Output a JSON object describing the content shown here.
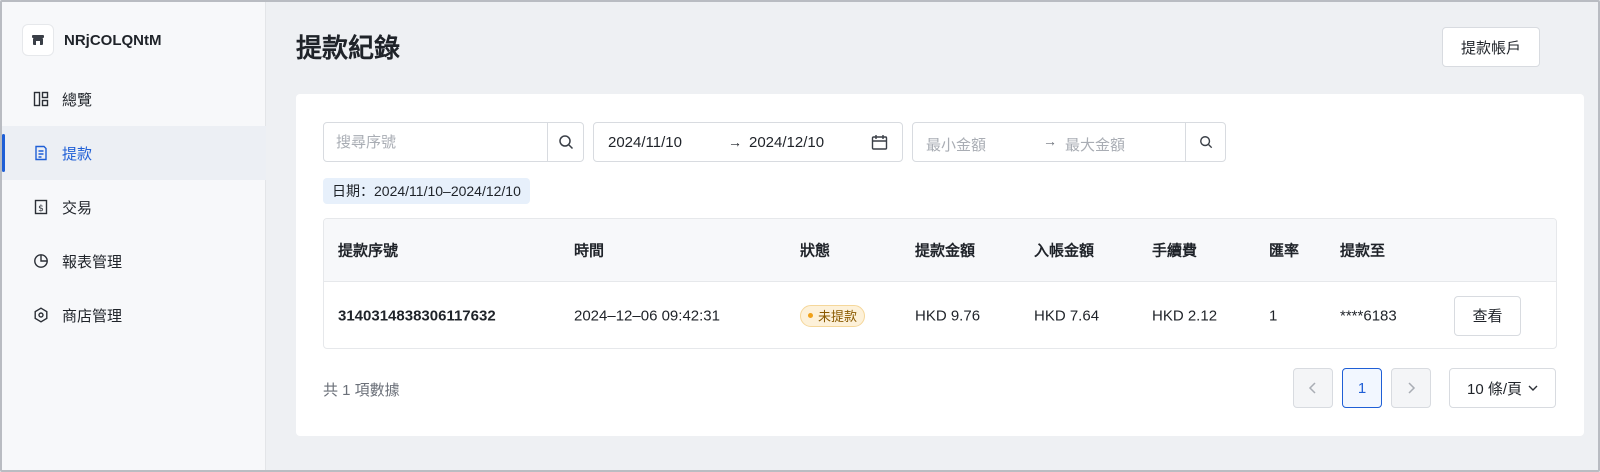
{
  "store": {
    "name": "NRjCOLQNtM",
    "icon": "store-icon"
  },
  "sidebar": {
    "items": [
      {
        "label": "總覽",
        "icon": "dashboard-icon",
        "active": false
      },
      {
        "label": "提款",
        "icon": "withdraw-document-icon",
        "active": true
      },
      {
        "label": "交易",
        "icon": "transaction-icon",
        "active": false
      },
      {
        "label": "報表管理",
        "icon": "pie-chart-icon",
        "active": false
      },
      {
        "label": "商店管理",
        "icon": "shop-settings-icon",
        "active": false
      }
    ]
  },
  "header": {
    "title": "提款紀錄",
    "account_button": "提款帳戶"
  },
  "filters": {
    "search_placeholder": "搜尋序號",
    "date_start": "2024/11/10",
    "date_arrow": "→",
    "date_end": "2024/12/10",
    "amount_min_placeholder": "最小金額",
    "amount_arrow": "→",
    "amount_max_placeholder": "最大金額",
    "active_tag": "日期：2024/11/10–2024/12/10"
  },
  "table": {
    "columns": [
      "提款序號",
      "時間",
      "狀態",
      "提款金額",
      "入帳金額",
      "手續費",
      "匯率",
      "提款至"
    ],
    "rows": [
      {
        "id": "3140314838306117632",
        "time": "2024–12–06 09:42:31",
        "status": "未提款",
        "amount": "HKD 9.76",
        "credited": "HKD 7.64",
        "fee": "HKD 2.12",
        "rate": "1",
        "to": "****6183",
        "action": "查看"
      }
    ]
  },
  "pagination": {
    "total_text": "共 1 項數據",
    "current_page": "1",
    "page_size": "10 條/頁"
  },
  "colors": {
    "accent": "#1f5fd6",
    "status_pending_bg": "#fdf1d9",
    "status_pending_text": "#8a5a00"
  }
}
